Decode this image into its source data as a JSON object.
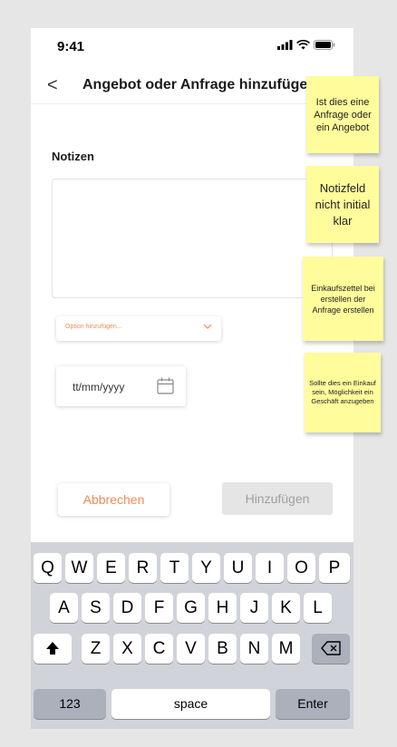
{
  "status": {
    "time": "9:41"
  },
  "nav": {
    "back_label": "<",
    "title": "Angebot oder Anfrage hinzufügen"
  },
  "form": {
    "notes_label": "Notizen",
    "notes_value": "",
    "option_placeholder": "Option hinzufügen...",
    "date_placeholder": "tt/mm/yyyy"
  },
  "buttons": {
    "cancel": "Abbrechen",
    "add": "Hinzufügen"
  },
  "keyboard": {
    "row1": [
      "Q",
      "W",
      "E",
      "R",
      "T",
      "Y",
      "U",
      "I",
      "O",
      "P"
    ],
    "row2": [
      "A",
      "S",
      "D",
      "F",
      "G",
      "H",
      "J",
      "K",
      "L"
    ],
    "row3": [
      "Z",
      "X",
      "C",
      "V",
      "B",
      "N",
      "M"
    ],
    "numbers": "123",
    "space": "space",
    "enter": "Enter"
  },
  "sticky_notes": [
    "Ist dies eine Anfrage oder ein Angebot",
    "Notizfeld nicht initial klar",
    "Einkaufszettel bei erstellen der Anfrage erstellen",
    "Sollte dies ein Einkauf sein, Möglichkeit ein Geschäft anzugeben"
  ],
  "colors": {
    "accent": "#ee8b56",
    "sticky": "#fffc9c",
    "keyboard_bg": "#d0d3d9"
  },
  "icons": [
    "signal-icon",
    "wifi-icon",
    "battery-icon",
    "back-chevron-icon",
    "chevron-down-icon",
    "calendar-icon",
    "shift-icon",
    "backspace-icon"
  ]
}
